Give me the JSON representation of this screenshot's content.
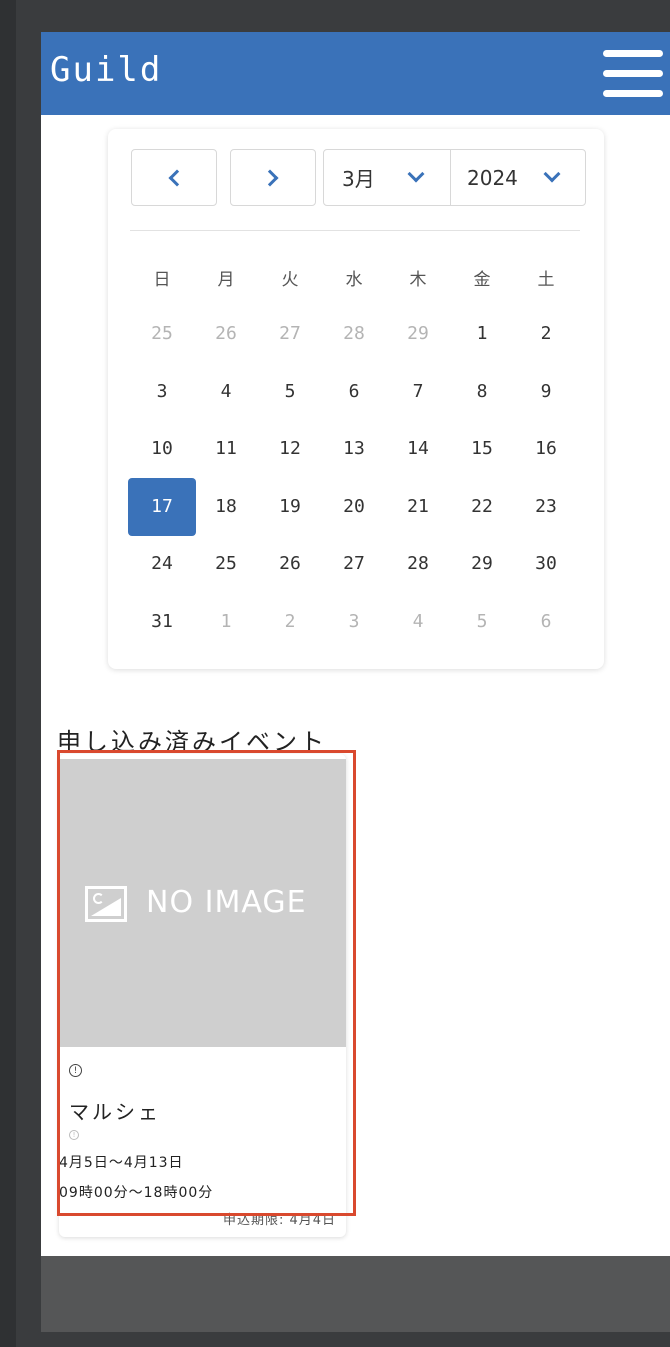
{
  "app": {
    "brand": "Guild"
  },
  "calendar": {
    "selected_month": "3月",
    "selected_year": "2024",
    "weekdays": [
      "日",
      "月",
      "火",
      "水",
      "木",
      "金",
      "土"
    ],
    "weeks": [
      [
        {
          "d": "25",
          "m": true
        },
        {
          "d": "26",
          "m": true
        },
        {
          "d": "27",
          "m": true
        },
        {
          "d": "28",
          "m": true
        },
        {
          "d": "29",
          "m": true
        },
        {
          "d": "1"
        },
        {
          "d": "2"
        }
      ],
      [
        {
          "d": "3"
        },
        {
          "d": "4"
        },
        {
          "d": "5"
        },
        {
          "d": "6"
        },
        {
          "d": "7"
        },
        {
          "d": "8"
        },
        {
          "d": "9"
        }
      ],
      [
        {
          "d": "10"
        },
        {
          "d": "11"
        },
        {
          "d": "12"
        },
        {
          "d": "13"
        },
        {
          "d": "14"
        },
        {
          "d": "15"
        },
        {
          "d": "16"
        }
      ],
      [
        {
          "d": "17",
          "s": true
        },
        {
          "d": "18"
        },
        {
          "d": "19"
        },
        {
          "d": "20"
        },
        {
          "d": "21"
        },
        {
          "d": "22"
        },
        {
          "d": "23"
        }
      ],
      [
        {
          "d": "24"
        },
        {
          "d": "25"
        },
        {
          "d": "26"
        },
        {
          "d": "27"
        },
        {
          "d": "28"
        },
        {
          "d": "29"
        },
        {
          "d": "30"
        }
      ],
      [
        {
          "d": "31"
        },
        {
          "d": "1",
          "m": true
        },
        {
          "d": "2",
          "m": true
        },
        {
          "d": "3",
          "m": true
        },
        {
          "d": "4",
          "m": true
        },
        {
          "d": "5",
          "m": true
        },
        {
          "d": "6",
          "m": true
        }
      ]
    ]
  },
  "events_section": {
    "title": "申し込み済みイベント",
    "events": [
      {
        "image_placeholder": "NO IMAGE",
        "name": "マルシェ",
        "date_range": "4月5日～4月13日",
        "time_range": "09時00分～18時00分",
        "deadline": "申込期限: 4月4日"
      }
    ]
  },
  "colors": {
    "header": "#3a72b9",
    "accent": "#3a72b9",
    "highlight": "#d9492e",
    "footer": "#555657"
  }
}
